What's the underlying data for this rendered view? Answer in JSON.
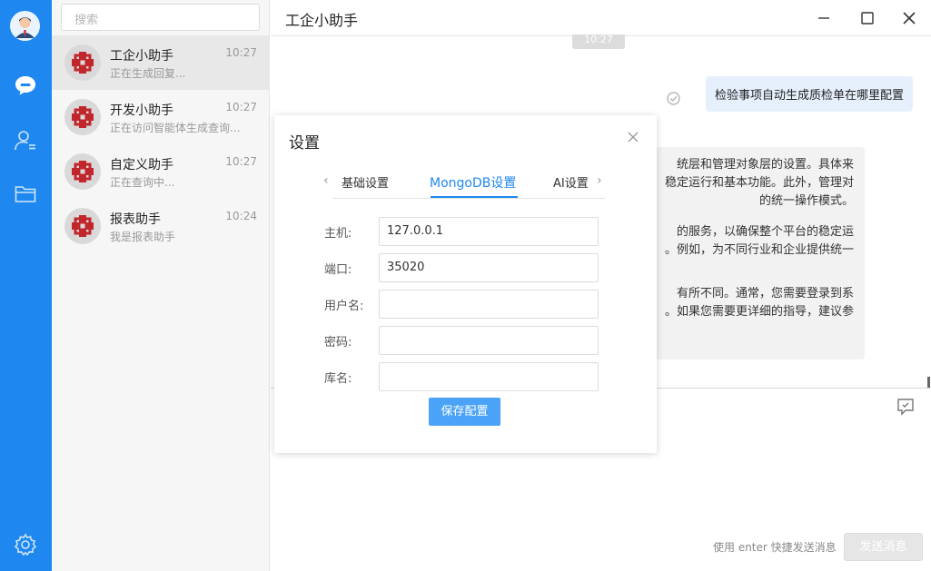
{
  "search": {
    "placeholder": "搜索"
  },
  "sessions": [
    {
      "name": "工企小助手",
      "preview": "正在生成回复...",
      "time": "10:27"
    },
    {
      "name": "开发小助手",
      "preview": "正在访问智能体生成查询...",
      "time": "10:27"
    },
    {
      "name": "自定义助手",
      "preview": "正在查询中...",
      "time": "10:27"
    },
    {
      "name": "报表助手",
      "preview": "我是报表助手",
      "time": "10:24"
    }
  ],
  "chat": {
    "title": "工企小助手",
    "time_chip": "10:27",
    "user_message": "检验事项自动生成质检单在哪里配置",
    "bot_lines": [
      "统层和管理对象层的设置。具体来",
      "稳定运行和基本功能。此外，管理对",
      "的统一操作模式。",
      "",
      "的服务，以确保整个平台的稳定运",
      "。例如，为不同行业和企业提供统一",
      "",
      "",
      "有所不同。通常，您需要登录到系",
      "。如果您需要更详细的指导，建议参"
    ],
    "send_hint": "使用 enter 快捷发送消息",
    "send_label": "发送消息"
  },
  "dialog": {
    "title": "设置",
    "tabs": [
      "基础设置",
      "MongoDB设置",
      "AI设置"
    ],
    "active_tab": "MongoDB设置",
    "fields": [
      {
        "label": "主机:",
        "value": "127.0.0.1"
      },
      {
        "label": "端口:",
        "value": "35020"
      },
      {
        "label": "用户名:",
        "value": ""
      },
      {
        "label": "密码:",
        "value": ""
      },
      {
        "label": "库名:",
        "value": ""
      }
    ],
    "save_label": "保存配置"
  },
  "colors": {
    "accent": "#1e88f0",
    "rail": "#1e88f0",
    "save_button": "#4aa3f6"
  },
  "icons": [
    "avatar",
    "chat-icon",
    "contacts-icon",
    "folder-icon",
    "settings-icon",
    "minimize-icon",
    "maximize-icon",
    "close-icon",
    "check-circle-icon",
    "reply-icon"
  ]
}
